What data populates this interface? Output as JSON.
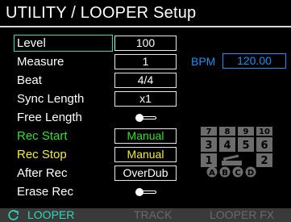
{
  "header": {
    "title": "UTILITY / LOOPER Setup"
  },
  "params": [
    {
      "label": "Level",
      "value": "100",
      "type": "value",
      "label_color": "#ffffff",
      "selected": true
    },
    {
      "label": "Measure",
      "value": "1",
      "type": "value",
      "label_color": "#ffffff"
    },
    {
      "label": "Beat",
      "value": "4/4",
      "type": "value",
      "label_color": "#ffffff"
    },
    {
      "label": "Sync Length",
      "value": "x1",
      "type": "value",
      "label_color": "#ffffff"
    },
    {
      "label": "Free Length",
      "value": "",
      "type": "toggle",
      "label_color": "#ffffff"
    },
    {
      "label": "Rec Start",
      "value": "Manual",
      "type": "value",
      "label_color": "#3adf2e"
    },
    {
      "label": "Rec Stop",
      "value": "Manual",
      "type": "value",
      "label_color": "#f4ec3b"
    },
    {
      "label": "After Rec",
      "value": "OverDub",
      "type": "value",
      "label_color": "#ffffff"
    },
    {
      "label": "Erase Rec",
      "value": "",
      "type": "toggle",
      "label_color": "#ffffff"
    }
  ],
  "bpm": {
    "label": "BPM",
    "value": "120.00",
    "color": "#1f8ff0"
  },
  "pedal_map": {
    "top_row": [
      "7",
      "8",
      "9",
      "10"
    ],
    "middle_row": [
      "3",
      "4",
      "5",
      "6"
    ],
    "bottom_row_left": "1",
    "bottom_row_right": "2",
    "expression_icon": "expression-pedal-icon",
    "circles": [
      "A",
      "B",
      "C",
      "D"
    ]
  },
  "tabs": [
    {
      "label": "LOOPER",
      "active": true
    },
    {
      "label": "TRACK",
      "active": false
    },
    {
      "label": "LOOPER FX",
      "active": false
    }
  ],
  "colors": {
    "accent": "#2fd9b5",
    "rec_start": "#3adf2e",
    "rec_stop": "#f4ec3b",
    "bpm": "#1f8ff0"
  }
}
